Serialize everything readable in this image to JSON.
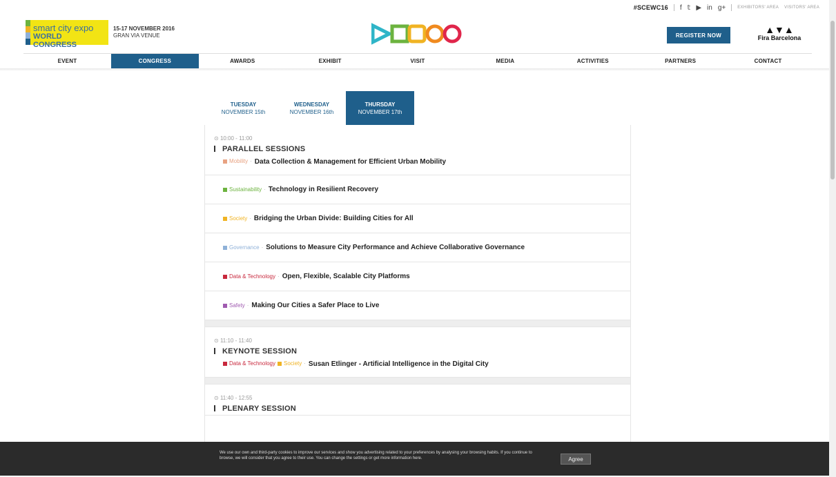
{
  "topbar": {
    "hashtag": "#SCEWC16",
    "social_icons": [
      "facebook-icon",
      "twitter-icon",
      "youtube-icon",
      "linkedin-icon",
      "googleplus-icon"
    ],
    "exhibitors_area": "EXHIBITORS' AREA",
    "visitors_area": "VISITORS' AREA"
  },
  "header": {
    "brand_line1": "smart city expo",
    "brand_line2": "WORLD CONGRESS",
    "dates_line1": "15-17 NOVEMBER 2016",
    "dates_line2": "GRAN VIA VENUE",
    "register_label": "REGISTER NOW",
    "fira_name": "Fira Barcelona"
  },
  "nav": {
    "items": [
      {
        "label": "EVENT"
      },
      {
        "label": "CONGRESS",
        "active": true
      },
      {
        "label": "AWARDS"
      },
      {
        "label": "EXHIBIT"
      },
      {
        "label": "VISIT"
      },
      {
        "label": "MEDIA"
      },
      {
        "label": "ACTIVITIES"
      },
      {
        "label": "PARTNERS"
      },
      {
        "label": "CONTACT"
      }
    ]
  },
  "days": [
    {
      "day": "TUESDAY",
      "date": "NOVEMBER 15th"
    },
    {
      "day": "WEDNESDAY",
      "date": "NOVEMBER 16th"
    },
    {
      "day": "THURSDAY",
      "date": "NOVEMBER 17th",
      "active": true
    }
  ],
  "schedule": [
    {
      "time": "10:00 - 11:00",
      "title": "PARALLEL SESSIONS",
      "sessions": [
        {
          "tags": [
            {
              "name": "Mobility",
              "color": "#e8a282"
            }
          ],
          "text": "Data Collection & Management for Efficient Urban Mobility"
        },
        {
          "tags": [
            {
              "name": "Sustainability",
              "color": "#6cb33f"
            }
          ],
          "text": "Technology in Resilient Recovery"
        },
        {
          "tags": [
            {
              "name": "Society",
              "color": "#f0b323"
            }
          ],
          "text": "Bridging the Urban Divide: Building Cities for All"
        },
        {
          "tags": [
            {
              "name": "Governance",
              "color": "#8fb1d8"
            }
          ],
          "text": "Solutions to Measure City Performance and Achieve Collaborative Governance"
        },
        {
          "tags": [
            {
              "name": "Data & Technology",
              "color": "#c8283d"
            }
          ],
          "text": "Open, Flexible, Scalable City Platforms"
        },
        {
          "tags": [
            {
              "name": "Safety",
              "color": "#a05bb0"
            }
          ],
          "text": "Making Our Cities a Safer Place to Live"
        }
      ]
    },
    {
      "time": "11:10 - 11:40",
      "title": "KEYNOTE SESSION",
      "sessions": [
        {
          "tags": [
            {
              "name": "Data & Technology",
              "color": "#c8283d"
            },
            {
              "name": "Society",
              "color": "#f0b323"
            }
          ],
          "text": "Susan Etlinger - Artificial Intelligence in the Digital City"
        }
      ]
    },
    {
      "time": "11:40 - 12:55",
      "title": "PLENARY SESSION",
      "sessions": []
    }
  ],
  "cookie": {
    "message": "We use our own and third-party cookies to improve our services and show you advertising related to your preferences by analysing your browsing habits. If you continue to browse, we will consider that you agree to their use. You can change the settings or get more information here.",
    "agree_label": "Agree"
  },
  "colors": {
    "primary": "#1f5f8b",
    "brand_yellow": "#f2e414"
  }
}
